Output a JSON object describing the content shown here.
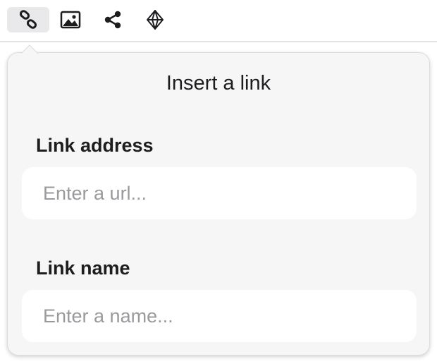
{
  "toolbar": {
    "buttons": [
      {
        "icon": "link-icon",
        "active": true
      },
      {
        "icon": "image-icon",
        "active": false
      },
      {
        "icon": "share-icon",
        "active": false
      },
      {
        "icon": "diamond-icon",
        "active": false
      }
    ]
  },
  "popover": {
    "title": "Insert a link",
    "link_address": {
      "label": "Link address",
      "placeholder": "Enter a url...",
      "value": ""
    },
    "link_name": {
      "label": "Link name",
      "placeholder": "Enter a name...",
      "value": ""
    }
  }
}
